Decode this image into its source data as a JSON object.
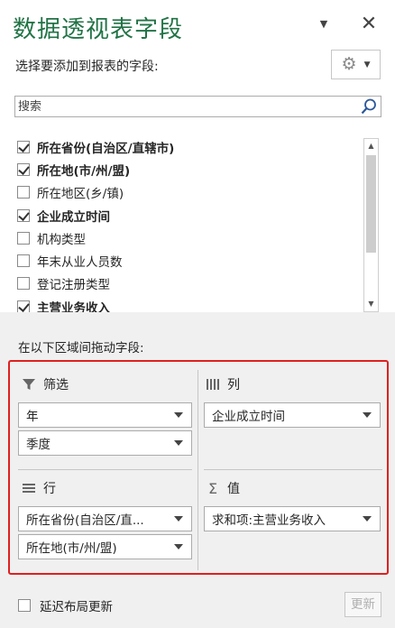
{
  "panel": {
    "title": "数据透视表字段",
    "subtitle": "选择要添加到报表的字段:",
    "search_placeholder": "搜索",
    "drag_label": "在以下区域间拖动字段:"
  },
  "fields": [
    {
      "label": "所在省份(自治区/直辖市)",
      "checked": true
    },
    {
      "label": "所在地(市/州/盟)",
      "checked": true
    },
    {
      "label": "所在地区(乡/镇)",
      "checked": false
    },
    {
      "label": "企业成立时间",
      "checked": true
    },
    {
      "label": "机构类型",
      "checked": false
    },
    {
      "label": "年末从业人员数",
      "checked": false
    },
    {
      "label": "登记注册类型",
      "checked": false
    },
    {
      "label": "主营业务收入",
      "checked": true
    }
  ],
  "areas": {
    "filter": {
      "title": "筛选",
      "items": [
        "年",
        "季度"
      ]
    },
    "columns": {
      "title": "列",
      "items": [
        "企业成立时间"
      ]
    },
    "rows": {
      "title": "行",
      "items": [
        "所在省份(自治区/直...",
        "所在地(市/州/盟)"
      ]
    },
    "values": {
      "title": "值",
      "items": [
        "求和项:主营业务收入"
      ]
    }
  },
  "footer": {
    "defer_label": "延迟布局更新",
    "update_label": "更新"
  },
  "colors": {
    "title": "#217346",
    "highlight_border": "#e02020"
  }
}
